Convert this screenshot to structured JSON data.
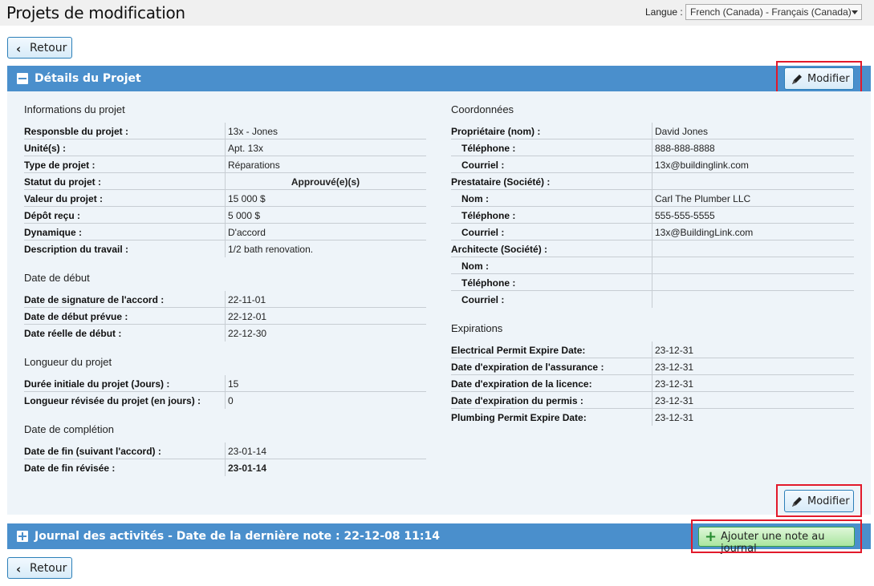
{
  "header": {
    "title": "Projets de modification",
    "language_label": "Langue :",
    "language_value": "French (Canada) - Français (Canada)"
  },
  "buttons": {
    "back_label": "Retour",
    "modify_label": "Modifier",
    "add_note_label": "Ajouter une note au journal"
  },
  "details": {
    "title": "Détails du Projet",
    "project_info": {
      "heading": "Informations du projet",
      "rows": [
        {
          "label": "Responsble du projet :",
          "value": "13x - Jones"
        },
        {
          "label": "Unité(s) :",
          "value": "Apt. 13x"
        },
        {
          "label": "Type de projet :",
          "value": "Réparations"
        },
        {
          "label": "Statut du projet :",
          "value": "Approuvé(e)(s)"
        },
        {
          "label": "Valeur du projet :",
          "value": "15 000 $"
        },
        {
          "label": "Dépôt reçu :",
          "value": "5 000 $"
        },
        {
          "label": "Dynamique :",
          "value": "D'accord"
        },
        {
          "label": "Description du travail :",
          "value": "1/2 bath renovation."
        }
      ]
    },
    "start_date": {
      "heading": "Date de début",
      "rows": [
        {
          "label": "Date de signature de l'accord :",
          "value": "22-11-01"
        },
        {
          "label": "Date de début prévue :",
          "value": "22-12-01"
        },
        {
          "label": "Date réelle de début :",
          "value": "22-12-30"
        }
      ]
    },
    "length": {
      "heading": "Longueur du projet",
      "rows": [
        {
          "label": "Durée initiale du projet (Jours) :",
          "value": "15"
        },
        {
          "label": "Longueur révisée du projet (en jours) :",
          "value": "0"
        }
      ]
    },
    "completion": {
      "heading": "Date de complétion",
      "rows": [
        {
          "label": "Date de fin (suivant l'accord) :",
          "value": "23-01-14"
        },
        {
          "label": "Date de fin révisée :",
          "value": "23-01-14"
        }
      ]
    },
    "contacts": {
      "heading": "Coordonnées",
      "rows": [
        {
          "label": "Propriétaire (nom) :",
          "value": "David Jones"
        },
        {
          "label": "Téléphone :",
          "value": "888-888-8888"
        },
        {
          "label": "Courriel :",
          "value": "13x@buildinglink.com"
        },
        {
          "label": "Prestataire (Société) :",
          "value": ""
        },
        {
          "label": "Nom :",
          "value": "Carl The Plumber LLC"
        },
        {
          "label": "Téléphone :",
          "value": "555-555-5555"
        },
        {
          "label": "Courriel :",
          "value": "13x@BuildingLink.com"
        },
        {
          "label": "Architecte (Société) :",
          "value": ""
        },
        {
          "label": "Nom :",
          "value": ""
        },
        {
          "label": "Téléphone :",
          "value": ""
        },
        {
          "label": "Courriel :",
          "value": ""
        }
      ]
    },
    "expirations": {
      "heading": "Expirations",
      "rows": [
        {
          "label": "Electrical Permit Expire Date:",
          "value": "23-12-31"
        },
        {
          "label": "Date d'expiration de l'assurance :",
          "value": "23-12-31"
        },
        {
          "label": "Date d'expiration de la licence:",
          "value": "23-12-31"
        },
        {
          "label": "Date d'expiration du permis :",
          "value": "23-12-31"
        },
        {
          "label": "Plumbing Permit Expire Date:",
          "value": "23-12-31"
        }
      ]
    }
  },
  "journal": {
    "title": "Journal des activités - Date de la dernière note : 22-12-08 11:14"
  },
  "colors": {
    "section_bar": "#4a8fcc",
    "panel_bg": "#eef4f9",
    "highlight": "#e2192b",
    "add_button": "#a9e59f"
  }
}
